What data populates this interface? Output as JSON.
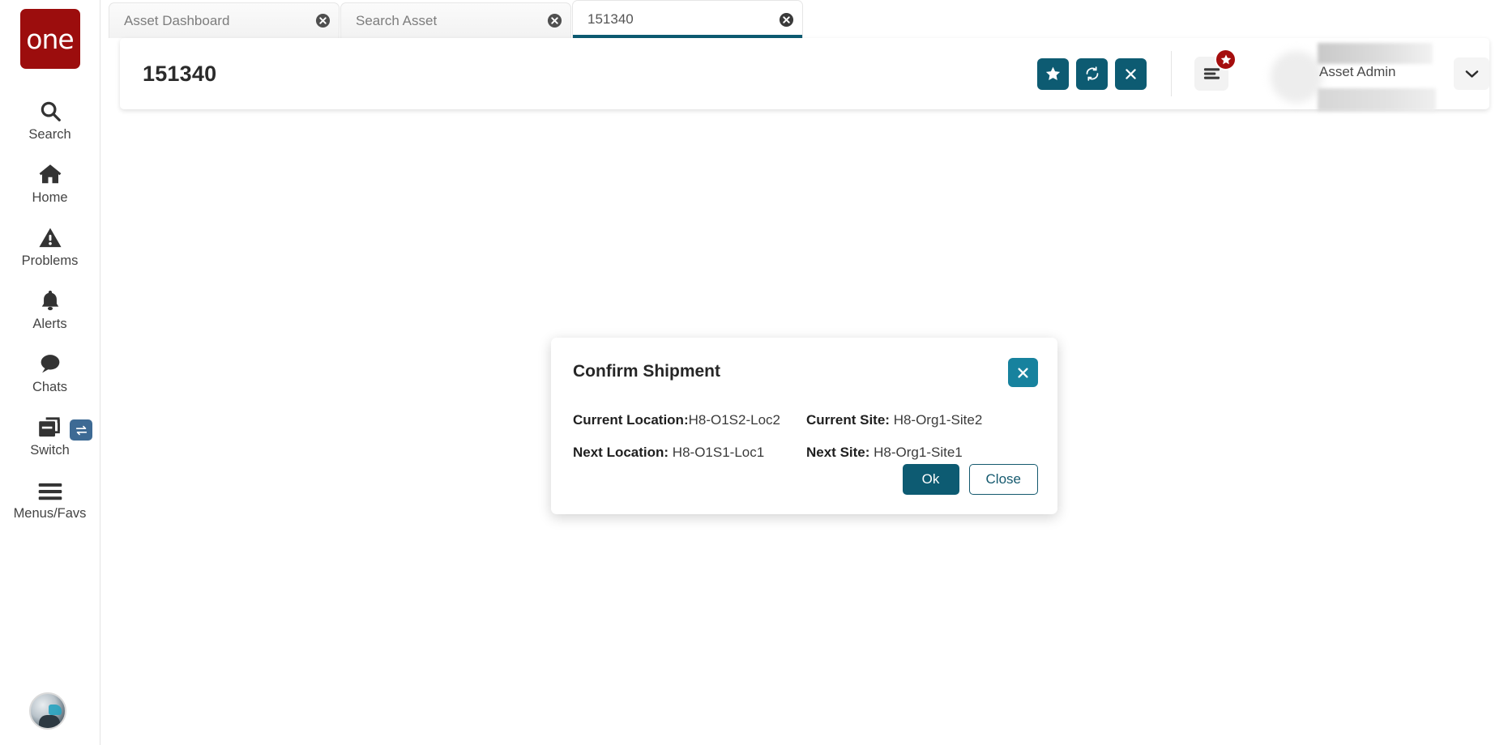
{
  "brand": {
    "logo_text": "one"
  },
  "sidebar": {
    "items": [
      {
        "label": "Search",
        "icon": "search-icon"
      },
      {
        "label": "Home",
        "icon": "home-icon"
      },
      {
        "label": "Problems",
        "icon": "warning-triangle-icon"
      },
      {
        "label": "Alerts",
        "icon": "bell-icon"
      },
      {
        "label": "Chats",
        "icon": "chat-bubble-icon"
      },
      {
        "label": "Switch",
        "icon": "copy-windows-icon",
        "badge_icon": "swap-arrows-icon"
      },
      {
        "label": "Menus/Favs",
        "icon": "hamburger-icon"
      }
    ],
    "avatar_icon": "user-avatar-icon"
  },
  "tabs": [
    {
      "label": "Asset Dashboard",
      "active": false,
      "close_icon": "close-circle-icon"
    },
    {
      "label": "Search Asset",
      "active": false,
      "close_icon": "close-circle-icon"
    },
    {
      "label": "151340",
      "active": true,
      "close_icon": "close-circle-icon"
    }
  ],
  "header": {
    "title": "151340",
    "actions": [
      {
        "name": "favorite-button",
        "icon": "star-icon"
      },
      {
        "name": "refresh-button",
        "icon": "refresh-icon"
      },
      {
        "name": "close-button",
        "icon": "x-icon"
      }
    ],
    "menu_button_icon": "hamburger-menu-icon",
    "menu_badge_icon": "star-badge-icon",
    "user_name": "Asset Admin",
    "chevron_icon": "chevron-down-icon"
  },
  "modal": {
    "title": "Confirm Shipment",
    "close_icon": "x-icon",
    "fields": [
      {
        "label": "Current Location:",
        "value": "H8-O1S2-Loc2"
      },
      {
        "label": "Current Site: ",
        "value": "H8-Org1-Site2"
      },
      {
        "label": "Next Location: ",
        "value": "H8-O1S1-Loc1"
      },
      {
        "label": "Next Site: ",
        "value": "H8-Org1-Site1"
      }
    ],
    "ok_label": "Ok",
    "close_label": "Close"
  },
  "colors": {
    "brand_red": "#9c0d0d",
    "teal": "#0d5b72",
    "teal_light": "#17829e",
    "badge_red": "#a50d0d",
    "switch_badge_blue": "#3d6a94",
    "canvas_gray": "#f0f0f0"
  }
}
